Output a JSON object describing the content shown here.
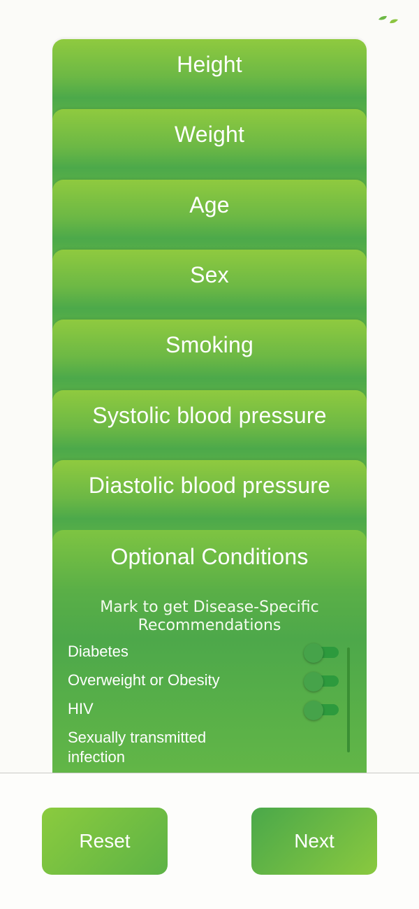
{
  "header": {
    "logo_icon": "leaf-logo-icon",
    "brand_color": "#8bc540"
  },
  "cards": [
    {
      "title": "Height"
    },
    {
      "title": "Weight"
    },
    {
      "title": "Age"
    },
    {
      "title": "Sex"
    },
    {
      "title": "Smoking"
    },
    {
      "title": "Systolic blood pressure"
    },
    {
      "title": "Diastolic blood pressure"
    }
  ],
  "optional": {
    "title": "Optional Conditions",
    "subtitle": "Mark to get Disease-Specific Recommendations",
    "conditions": [
      {
        "label": "Diabetes",
        "checked": false
      },
      {
        "label": "Overweight or Obesity",
        "checked": false
      },
      {
        "label": "HIV",
        "checked": false
      },
      {
        "label": "Sexually transmitted infection",
        "checked": false
      }
    ]
  },
  "footer": {
    "reset_label": "Reset",
    "next_label": "Next"
  },
  "colors": {
    "accent_light": "#8bc540",
    "accent_dark": "#4aa84a",
    "background": "#fbfbf8"
  }
}
